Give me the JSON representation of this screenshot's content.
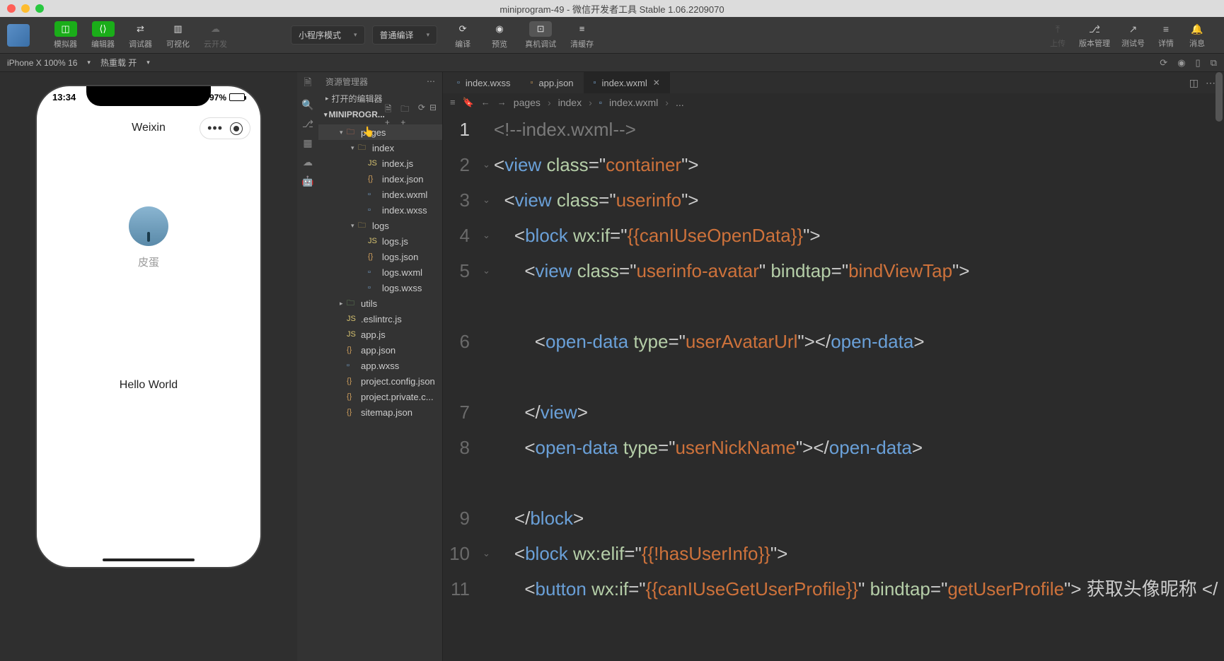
{
  "window": {
    "title": "miniprogram-49 - 微信开发者工具 Stable 1.06.2209070"
  },
  "toolbar": {
    "left": [
      {
        "icon": "◫",
        "label": "模拟器",
        "active": true
      },
      {
        "icon": "⟨⟩",
        "label": "编辑器",
        "active": true
      },
      {
        "icon": "⇄",
        "label": "调试器"
      },
      {
        "icon": "▥",
        "label": "可视化"
      },
      {
        "icon": "☁",
        "label": "云开发",
        "dim": true
      }
    ],
    "mode_dd": "小程序模式",
    "compile_dd": "普通编译",
    "center": [
      {
        "icon": "⟳",
        "label": "编译"
      },
      {
        "icon": "◉",
        "label": "预览"
      },
      {
        "icon": "⊡",
        "label": "真机调试",
        "hl": true
      },
      {
        "icon": "≡",
        "label": "清缓存"
      }
    ],
    "right": [
      {
        "icon": "⤒",
        "label": "上传",
        "dim": true
      },
      {
        "icon": "⎇",
        "label": "版本管理"
      },
      {
        "icon": "↗",
        "label": "测试号"
      },
      {
        "icon": "≡",
        "label": "详情"
      },
      {
        "icon": "🔔",
        "label": "消息"
      }
    ]
  },
  "devbar": {
    "device": "iPhone X 100% 16",
    "hot": "热重载 开"
  },
  "phone": {
    "time": "13:34",
    "battery_pct": "97%",
    "nav_title": "Weixin",
    "nickname": "皮蛋",
    "hello": "Hello World"
  },
  "explorer": {
    "header": "资源管理器",
    "open_editors": "打开的编辑器",
    "project": "MINIPROGR...",
    "tree": [
      {
        "depth": 1,
        "type": "folder",
        "open": true,
        "name": "pages",
        "color": "red",
        "sel": true
      },
      {
        "depth": 2,
        "type": "folder",
        "open": true,
        "name": "index",
        "color": "yel"
      },
      {
        "depth": 3,
        "type": "file",
        "name": "index.js",
        "ext": "js"
      },
      {
        "depth": 3,
        "type": "file",
        "name": "index.json",
        "ext": "json"
      },
      {
        "depth": 3,
        "type": "file",
        "name": "index.wxml",
        "ext": "wxml"
      },
      {
        "depth": 3,
        "type": "file",
        "name": "index.wxss",
        "ext": "wxss"
      },
      {
        "depth": 2,
        "type": "folder",
        "open": true,
        "name": "logs",
        "color": "yel"
      },
      {
        "depth": 3,
        "type": "file",
        "name": "logs.js",
        "ext": "js"
      },
      {
        "depth": 3,
        "type": "file",
        "name": "logs.json",
        "ext": "json"
      },
      {
        "depth": 3,
        "type": "file",
        "name": "logs.wxml",
        "ext": "wxml"
      },
      {
        "depth": 3,
        "type": "file",
        "name": "logs.wxss",
        "ext": "wxss"
      },
      {
        "depth": 1,
        "type": "folder",
        "open": false,
        "name": "utils",
        "color": "grn"
      },
      {
        "depth": 1,
        "type": "file",
        "name": ".eslintrc.js",
        "ext": "js"
      },
      {
        "depth": 1,
        "type": "file",
        "name": "app.js",
        "ext": "js"
      },
      {
        "depth": 1,
        "type": "file",
        "name": "app.json",
        "ext": "json"
      },
      {
        "depth": 1,
        "type": "file",
        "name": "app.wxss",
        "ext": "wxss"
      },
      {
        "depth": 1,
        "type": "file",
        "name": "project.config.json",
        "ext": "json"
      },
      {
        "depth": 1,
        "type": "file",
        "name": "project.private.c...",
        "ext": "json"
      },
      {
        "depth": 1,
        "type": "file",
        "name": "sitemap.json",
        "ext": "json"
      }
    ]
  },
  "tabs": [
    {
      "icon": "wxss",
      "label": "index.wxss"
    },
    {
      "icon": "json",
      "label": "app.json"
    },
    {
      "icon": "wxml",
      "label": "index.wxml",
      "active": true,
      "close": true
    }
  ],
  "breadcrumb": [
    "pages",
    "index",
    "index.wxml",
    "..."
  ],
  "code": {
    "lines": [
      {
        "n": 1,
        "fold": "",
        "html": "<span class='c-cmt'>&lt;!--index.wxml--&gt;</span>"
      },
      {
        "n": 2,
        "fold": "⌄",
        "html": "<span class='c-punct'>&lt;</span><span class='c-tag'>view</span> <span class='c-attr'>class</span><span class='c-punct'>=\"</span><span class='c-str'>container</span><span class='c-punct'>\"&gt;</span>"
      },
      {
        "n": 3,
        "fold": "⌄",
        "html": "  <span class='c-punct'>&lt;</span><span class='c-tag'>view</span> <span class='c-attr'>class</span><span class='c-punct'>=\"</span><span class='c-str'>userinfo</span><span class='c-punct'>\"&gt;</span>"
      },
      {
        "n": 4,
        "fold": "⌄",
        "html": "    <span class='c-punct'>&lt;</span><span class='c-tag'>block</span> <span class='c-attr'>wx:if</span><span class='c-punct'>=\"</span><span class='c-str'>{{canIUseOpenData}}</span><span class='c-punct'>\"&gt;</span>"
      },
      {
        "n": 5,
        "fold": "⌄",
        "html": "      <span class='c-punct'>&lt;</span><span class='c-tag'>view</span> <span class='c-attr'>class</span><span class='c-punct'>=\"</span><span class='c-str'>userinfo-avatar</span><span class='c-punct'>\"</span> <span class='c-attr'>bindtap</span><span class='c-punct'>=\"</span><span class='c-str'>bindViewTap</span><span class='c-punct'>\"&gt;</span>"
      },
      {
        "n": 6,
        "fold": "",
        "html": "        <span class='c-punct'>&lt;</span><span class='c-tag'>open-data</span> <span class='c-attr'>type</span><span class='c-punct'>=\"</span><span class='c-str'>userAvatarUrl</span><span class='c-punct'>\"&gt;&lt;/</span><span class='c-tag'>open-data</span><span class='c-punct'>&gt;</span>"
      },
      {
        "n": 7,
        "fold": "",
        "html": "      <span class='c-punct'>&lt;/</span><span class='c-tag'>view</span><span class='c-punct'>&gt;</span>"
      },
      {
        "n": 8,
        "fold": "",
        "html": "      <span class='c-punct'>&lt;</span><span class='c-tag'>open-data</span> <span class='c-attr'>type</span><span class='c-punct'>=\"</span><span class='c-str'>userNickName</span><span class='c-punct'>\"&gt;&lt;/</span><span class='c-tag'>open-data</span><span class='c-punct'>&gt;</span>"
      },
      {
        "n": 9,
        "fold": "",
        "html": "    <span class='c-punct'>&lt;/</span><span class='c-tag'>block</span><span class='c-punct'>&gt;</span>"
      },
      {
        "n": 10,
        "fold": "⌄",
        "html": "    <span class='c-punct'>&lt;</span><span class='c-tag'>block</span> <span class='c-attr'>wx:elif</span><span class='c-punct'>=\"</span><span class='c-str'>{{!hasUserInfo}}</span><span class='c-punct'>\"&gt;</span>"
      },
      {
        "n": 11,
        "fold": "",
        "html": "      <span class='c-punct'>&lt;</span><span class='c-tag'>button</span> <span class='c-attr'>wx:if</span><span class='c-punct'>=\"</span><span class='c-str'>{{canIUseGetUserProfile}}</span><span class='c-punct'>\"</span> <span class='c-attr'>bindtap</span><span class='c-punct'>=\"</span><span class='c-str'>getUserProfile</span><span class='c-punct'>\"&gt;</span><span class='c-txt'> 获取头像昵称 </span><span class='c-punct'>&lt;/</span>"
      }
    ]
  }
}
